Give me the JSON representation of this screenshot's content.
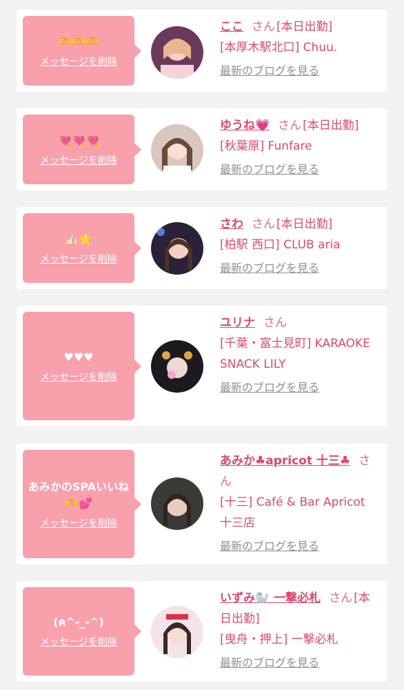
{
  "delete_label": "メッセージを削除",
  "blog_label": "最新のブログを見る",
  "san": "さん",
  "cards": [
    {
      "message": "🫶🫶🫶",
      "name": "ここ",
      "status": "[本日出勤]",
      "location": "[本厚木駅北口] Chuu."
    },
    {
      "message": "💘💘💘",
      "name": "ゆうね💗",
      "status": "[本日出勤]",
      "location": "[秋葉原] Funfare"
    },
    {
      "message": "👍🏻⭐",
      "name": "さわ",
      "status": "[本日出勤]",
      "location": "[柏駅 西口] CLUB aria"
    },
    {
      "message": "♥♥♥",
      "name": "ユリナ",
      "status": "",
      "location": "[千葉・富士見町] KARAOKE SNACK LILY"
    },
    {
      "message": "あみかのSPAいいね🫶💕",
      "name": "あみか♣apricot 十三♣",
      "status": "",
      "location": "[十三] Café & Bar Apricot 十三店"
    },
    {
      "message": "(ฅ^-_-^)",
      "name": "いずみ🦭 一撃必札",
      "status": "[本日出勤]",
      "location": "[曳舟・押上] 一撃必札"
    }
  ],
  "colors": {
    "bubble": "#f9a0ad",
    "accent": "#d84a6e",
    "muted": "#8f8f8f",
    "background": "#f2f2f2"
  }
}
